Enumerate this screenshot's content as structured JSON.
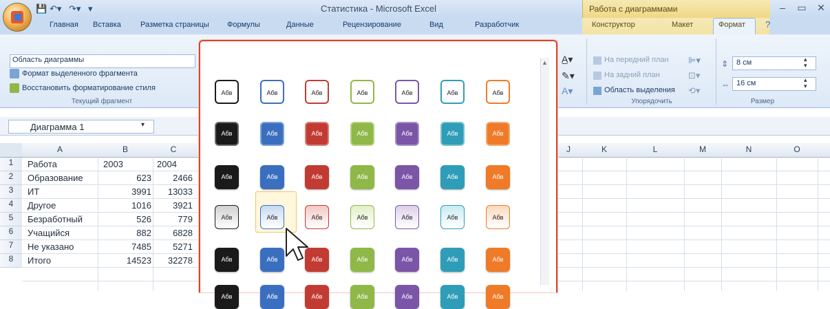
{
  "window": {
    "title": "Статистика - Microsoft Excel",
    "context_title": "Работа с диаграммами"
  },
  "tabs": [
    {
      "label": "Главная"
    },
    {
      "label": "Вставка"
    },
    {
      "label": "Разметка страницы"
    },
    {
      "label": "Формулы"
    },
    {
      "label": "Данные"
    },
    {
      "label": "Рецензирование"
    },
    {
      "label": "Вид"
    },
    {
      "label": "Разработчик"
    },
    {
      "label": "Конструктор"
    },
    {
      "label": "Макет"
    },
    {
      "label": "Формат"
    }
  ],
  "ribbon": {
    "current_fragment": {
      "selector": "Область диаграммы",
      "format_selection": "Формат выделенного фрагмента",
      "reset_style": "Восстановить форматирование стиля",
      "group_label": "Текущий фрагмент"
    },
    "arrange": {
      "bring_forward": "На передний план",
      "send_backward": "На задний план",
      "selection_pane": "Область выделения",
      "group_label": "Упорядочить"
    },
    "size": {
      "height": "8 см",
      "width": "16 см",
      "group_label": "Размер"
    }
  },
  "namebox": "Диаграмма 1",
  "columns": [
    "A",
    "B",
    "C",
    "J",
    "K",
    "L",
    "M",
    "N",
    "O"
  ],
  "rows": [
    {
      "n": "1",
      "a": "Работа",
      "b": "2003",
      "c": "2004"
    },
    {
      "n": "2",
      "a": "Образование",
      "b": "623",
      "c": "2466"
    },
    {
      "n": "3",
      "a": "ИТ",
      "b": "3991",
      "c": "13033"
    },
    {
      "n": "4",
      "a": "Другое",
      "b": "1016",
      "c": "3921"
    },
    {
      "n": "5",
      "a": "Безработный",
      "b": "526",
      "c": "779"
    },
    {
      "n": "6",
      "a": "Учащийся",
      "b": "882",
      "c": "6828"
    },
    {
      "n": "7",
      "a": "Не указано",
      "b": "7485",
      "c": "5271"
    },
    {
      "n": "8",
      "a": "Итого",
      "b": "14523",
      "c": "32278"
    }
  ],
  "gallery": {
    "tile_label": "Абв",
    "colors": [
      "#1a1a1a",
      "#3a6fc0",
      "#c23b32",
      "#8fb848",
      "#7a55a8",
      "#2f9db8",
      "#ef7b28"
    ],
    "light_fills": [
      "#d0d0d0",
      "#c8d9f0",
      "#f3c8c4",
      "#e3efc9",
      "#ddd0ea",
      "#c8ebf3",
      "#fbd9bd"
    ],
    "hovered": {
      "row": 4,
      "col": 2
    }
  }
}
